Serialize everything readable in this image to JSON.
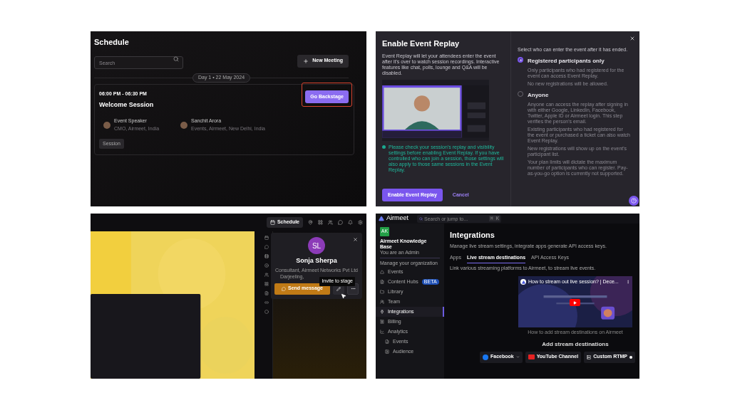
{
  "schedule": {
    "title": "Schedule",
    "search": {
      "placeholder": "Search"
    },
    "new_button": "New Meeting",
    "day": "Day 1 • 22 May 2024",
    "session": {
      "time": "06:00 PM - 06:30 PM",
      "title": "Welcome Session",
      "action": {
        "label": "Go Backstage",
        "highlighted": true
      },
      "speakers": [
        {
          "name": "Event Speaker",
          "subtitle": "CMO, Airmeet, India"
        },
        {
          "name": "Sanchit Arora",
          "subtitle": "Events, Airmeet, New Delhi, India"
        }
      ],
      "tag": "Session"
    }
  },
  "replay_dialog": {
    "title": "Enable Event Replay",
    "description": "Event Replay will let your attendees enter the event after it's over to watch session recordings. Interactive features like chat, polls, lounge and Q&A will be disabled.",
    "note": "Please check your session's replay and visibility settings before enabling Event Replay. If you have controlled who can join a session, those settings will also apply to those same sessions in the Event Replay.",
    "prompt": "Select who can enter the event after it has ended.",
    "options": [
      {
        "label": "Registered participants only",
        "selected": true,
        "details": [
          "Only participants who had registered for the event can access Event Replay.",
          "No new registrations will be allowed."
        ]
      },
      {
        "label": "Anyone",
        "selected": false,
        "details": [
          "Anyone can access the replay after signing in with either Google, LinkedIn, Facebook, Twitter, Apple ID or Airmeet login. This step verifies the person's email.",
          "Existing participants who had registered for the event or purchased a ticket can also watch Event Replay.",
          "New registrations will show up on the event's participant list.",
          "Your plan limits will dictate the maximum number of participants who can register. Pay-as-you-go option is currently not supported."
        ]
      }
    ],
    "primary_button": "Enable Event Replay",
    "cancel_button": "Cancel"
  },
  "stage": {
    "schedule_button": "Schedule",
    "profile": {
      "initials": "SL",
      "name": "Sonja Sherpa",
      "role": "Consultant, Airmeet Networks Pvt Ltd",
      "location": "Darjeeling,",
      "tooltip": "Invite to stage",
      "message_button": "Send message"
    }
  },
  "integrations": {
    "logo": "Airmeet",
    "search": {
      "placeholder": "Search or jump to...",
      "shortcut": "⌘ K"
    },
    "org": {
      "initials": "AK",
      "name": "Airmeet Knowledge Base",
      "role": "You are an Admin"
    },
    "section": "Manage your organization",
    "sidebar": [
      {
        "label": "Events",
        "selected": false
      },
      {
        "label": "Content Hubs",
        "badge": "BETA",
        "selected": false
      },
      {
        "label": "Library",
        "selected": false
      },
      {
        "label": "Team",
        "selected": false
      },
      {
        "label": "Integrations",
        "selected": true
      },
      {
        "label": "Billing",
        "selected": false
      },
      {
        "label": "Analytics",
        "selected": false,
        "children": [
          {
            "label": "Events",
            "selected": false
          },
          {
            "label": "Audience",
            "selected": false
          }
        ]
      }
    ],
    "title": "Integrations",
    "subtitle": "Manage live stream settings, integrate apps generate API access keys.",
    "tabs": [
      {
        "label": "Apps",
        "selected": false
      },
      {
        "label": "Live stream destinations",
        "selected": true
      },
      {
        "label": "API Access Keys",
        "selected": false
      }
    ],
    "tab_description": "Link various streaming platforms to Airmeet, to stream live events.",
    "video": {
      "title": "How to stream out live session? | Dece...",
      "caption": "How to add stream destinations on Airmeet"
    },
    "destinations_title": "Add stream destinations",
    "destinations": [
      {
        "kind": "facebook",
        "label": "Facebook"
      },
      {
        "kind": "youtube",
        "label": "YouTube Channel"
      },
      {
        "kind": "rtmp",
        "label": "Custom RTMP"
      }
    ]
  }
}
